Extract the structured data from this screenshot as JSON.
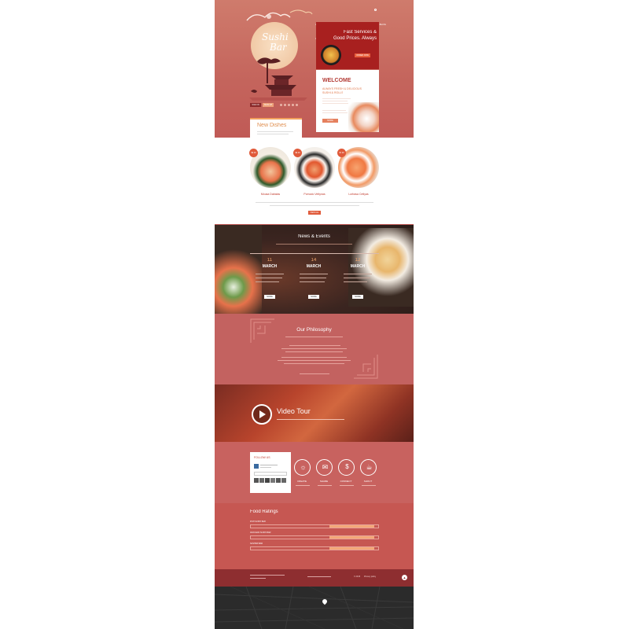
{
  "nav": [
    "ABOUT US",
    "SERVICES",
    "GALLERY",
    "BLOG",
    "CONTACTS"
  ],
  "hero": {
    "logo_line1": "Sushi",
    "logo_line2": "Bar",
    "signin": "SIGN IN",
    "signup": "SIGN UP"
  },
  "promo": {
    "title": "Fast Services & Good Prices. Always",
    "button": "ORDER NOW"
  },
  "welcome": {
    "title": "WELCOME",
    "subtitle1": "ALWAYS FRESH & DELICIOUS",
    "subtitle2": "SUSHI & ROLLS",
    "button": "MORE"
  },
  "new_dishes": {
    "title": "New Dishes"
  },
  "dishes": [
    {
      "name": "Mousa Dabalas",
      "badge": "$9.00"
    },
    {
      "name": "Pomodo Veltynas",
      "badge": "$8.00"
    },
    {
      "name": "Lorbasa Cetlyas",
      "badge": "$7.00"
    }
  ],
  "dishes_button": "VIEW ALL",
  "news": {
    "title": "News & Events",
    "events": [
      {
        "day": "11",
        "month": "MARCH",
        "button": "MORE"
      },
      {
        "day": "14",
        "month": "MARCH",
        "button": "MORE"
      },
      {
        "day": "12",
        "month": "MARCH",
        "button": "MORE"
      }
    ]
  },
  "philosophy": {
    "title": "Our Philosophy"
  },
  "video": {
    "title": "Video Tour"
  },
  "follow": {
    "title": "FOLLOW US"
  },
  "services": [
    {
      "icon": "compass-icon",
      "label": "CREATE"
    },
    {
      "icon": "envelope-icon",
      "label": "SHARE"
    },
    {
      "icon": "dollar-icon",
      "label": "CONNECT"
    },
    {
      "icon": "coffee-cup-icon",
      "label": "SHOUT"
    }
  ],
  "ratings": {
    "title": "Food Ratings",
    "items": [
      {
        "label": "FISH SUSHI BAR",
        "percent": 0.97
      },
      {
        "label": "AVOCADO SUSHI BAR",
        "percent": 0.97
      },
      {
        "label": "SASHIMI BAR",
        "percent": 0.97
      }
    ]
  },
  "footer": {
    "copyright": "© 2015",
    "privacy": "Privacy policy"
  }
}
